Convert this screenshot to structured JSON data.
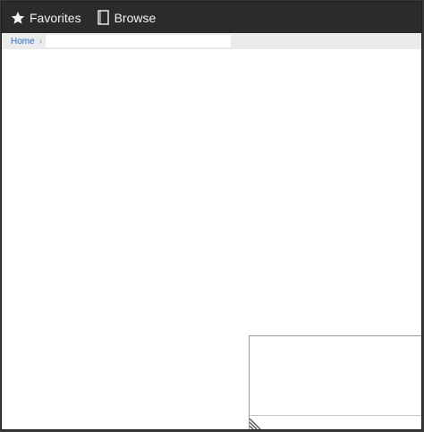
{
  "topbar": {
    "favorites": {
      "label": "Favorites",
      "icon": "star-icon"
    },
    "browse": {
      "label": "Browse",
      "icon": "book-icon"
    }
  },
  "breadcrumb": {
    "home_label": "Home",
    "separator": "›",
    "path_value": ""
  },
  "colors": {
    "topbar_bg": "#2b2b2b",
    "crumb_link": "#2a6fd6",
    "crumb_bg": "#ebebeb"
  }
}
